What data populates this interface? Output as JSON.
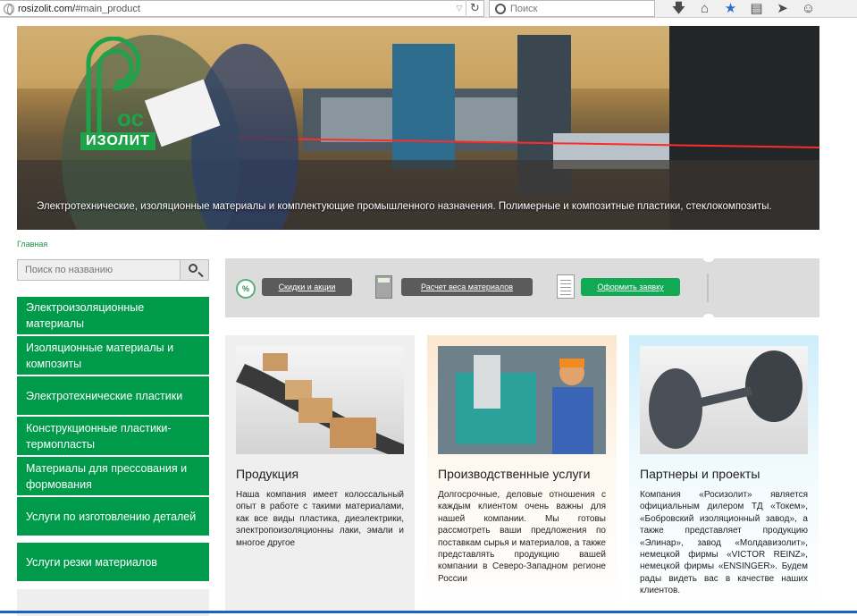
{
  "browser": {
    "url_host": "rosizolit.com/",
    "url_hash": "#main_product",
    "search_placeholder": "Поиск",
    "toolbar_icons": [
      "download-icon",
      "home-icon",
      "bookmark-star-icon",
      "clipboard-icon",
      "send-icon",
      "smiley-icon"
    ]
  },
  "hero": {
    "logo_text": "ИЗОЛИТ",
    "caption": "Электротехнические, изоляционные материалы и комплектующие промышленного назначения. Полимерные и композитные пластики, стеклокомпозиты."
  },
  "breadcrumb": "Главная",
  "sidebar": {
    "search_placeholder": "Поиск по названию",
    "items": [
      {
        "label": "Электроизоляционные материалы"
      },
      {
        "label": "Изоляционные материалы и композиты"
      },
      {
        "label": "Электротехнические пластики"
      },
      {
        "label": "Конструкционные пластики-термопласты"
      },
      {
        "label": "Материалы для прессования и формования"
      },
      {
        "label": "Услуги по изготовлению деталей"
      },
      {
        "label": "Услуги резки материалов"
      }
    ]
  },
  "toolbar": {
    "discounts": "Скидки и акции",
    "weight_calc": "Расчет веса материалов",
    "order": "Оформить заявку"
  },
  "cards": [
    {
      "title": "Продукция",
      "text": "Наша компания имеет колоссальный опыт в работе с такими материалами, как все виды пластика, диеэлектрики, электропоизоляционны лаки, эмали и многое другое"
    },
    {
      "title": "Производственные услуги",
      "text": "Долгосрочные, деловые отношения с каждым клиентом очень важны для нашей компании. Мы готовы рассмотреть ваши предложения по поставкам сырья и материалов, а также представлять продукцию вашей компании в Северо-Западном регионе России"
    },
    {
      "title": "Партнеры и проекты",
      "text": "Компания «Росизолит» является официальным дилером ТД «Токем», «Бобровский изоляционный завод», а также представляет продукцию «Элинар», завод «Молдавизолит», немецкой фирмы «VICTOR REINZ», немецкой фирмы «ENSINGER». Будем рады видеть вас в качестве наших клиентов."
    }
  ],
  "colors": {
    "brand_green": "#009b4a",
    "button_green": "#12a955",
    "button_dark": "#5b5b5b"
  }
}
